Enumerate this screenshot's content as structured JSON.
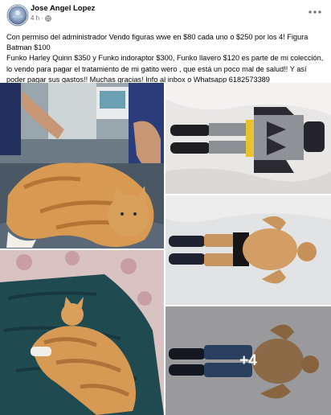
{
  "post": {
    "author": "Jose Angel Lopez",
    "time": "4 h",
    "separator": "·",
    "text": "Con permiso del administrador Vendo figuras wwe en $80 cada uno o $250 por los 4! Figura Batman $100\nFunko Harley Quinn $350 y Funko indoraptor $300, Funko llavero $120 es parte de mi colección, lo vendo para pagar el tratamiento de mi gatito wero , que está un poco mal de salud!! Y así poder pagar sus gastos!! Muchas gracias! Info al inbox o Whatsapp 6182573389"
  },
  "icons": {
    "privacy": "globe-icon",
    "options": "more-options-icon"
  },
  "gallery": {
    "photos": [
      {
        "name": "cat-at-vet"
      },
      {
        "name": "batman-figure"
      },
      {
        "name": "wrestler-figure-1"
      },
      {
        "name": "cat-on-blanket"
      },
      {
        "name": "wrestler-figure-2"
      }
    ],
    "more_count": "+4"
  },
  "colors": {
    "text_primary": "#050505",
    "text_secondary": "#65676b"
  }
}
